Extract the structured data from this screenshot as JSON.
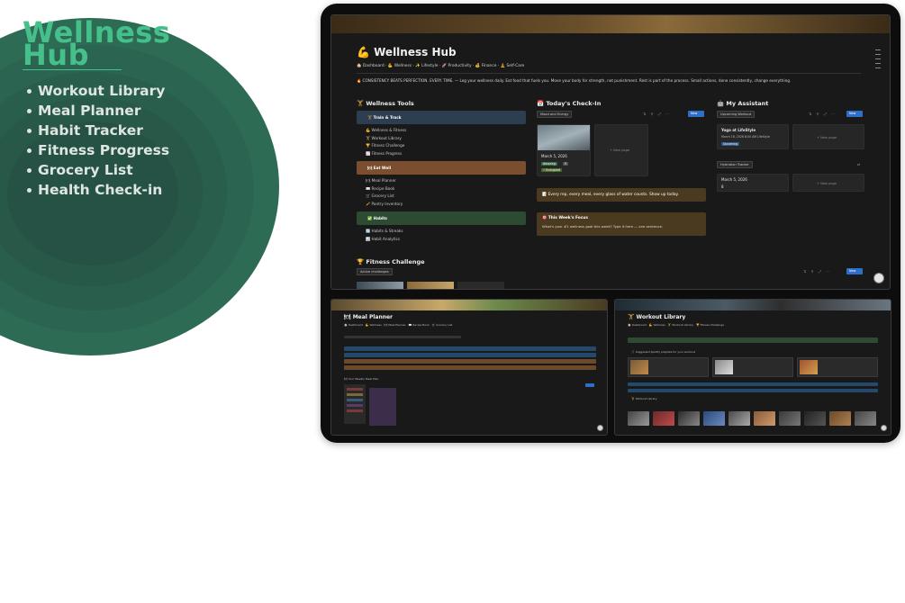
{
  "promo": {
    "brand_line1": "Wellness",
    "brand_line2": "Hub",
    "features": [
      "Workout Library",
      "Meal Planner",
      "Habit Tracker",
      "Fitness Progress",
      "Grocery List",
      "Health Check-in"
    ]
  },
  "main_page": {
    "title": "💪 Wellness Hub",
    "breadcrumb": "🏠 Dashboard · 💪 Wellness · ✨ Lifestyle · 🚀 Productivity · 💰 Finance · 🧘 Self-Care",
    "quote": "🔥 CONSISTENCY BEATS PERFECTION. EVERY. TIME. — Log your wellness daily. Eat food that fuels you. Move your body for strength, not punishment. Rest is part of the process. Small actions, done consistently, change everything.",
    "tools": {
      "heading": "🏋 Wellness Tools",
      "train_label": "🏋 Train & Track",
      "train_links": [
        "💪 Wellness & Fitness",
        "🏋 Workout Library",
        "🏆 Fitness Challenge",
        "📈 Fitness Progress"
      ],
      "eat_label": "🍽 Eat Well",
      "eat_links": [
        "🍽 Meal Planner",
        "📖 Recipe Book",
        "🛒 Grocery List",
        "🥕 Pantry Inventory"
      ],
      "habits_label": "✅ Habits",
      "habits_links": [
        "🔄 Habits & Streaks",
        "📊 Habit Analytics"
      ]
    },
    "checkin": {
      "heading": "📅 Today's Check-In",
      "tab": "Mood and Energy",
      "new_btn": "New",
      "card_date": "March 5, 2026",
      "card_tag1": "Amazing",
      "card_tag2": "5",
      "card_tag3": "⚡ Energized",
      "new_page": "+ New page",
      "callout1": "📝 Every rep, every meal, every glass of water counts. Show up today.",
      "focus_title": "🎯 This Week's Focus",
      "focus_text": "What's your #1 wellness goal this week? Type it here — one sentence."
    },
    "assistant": {
      "heading": "🤖 My Assistant",
      "tab": "Upcoming Workout",
      "new_btn": "New",
      "card_title": "Yoga at LifeStyle",
      "card_meta": "March 16, 2026 8:00 AM  LifeStyle",
      "card_pill": "Upcoming",
      "new_page": "+ New page",
      "tab2": "Hydration Tracker",
      "card2_date": "March 5, 2026",
      "card2_val": "8",
      "new_page2": "+ New page"
    },
    "challenge": {
      "heading": "🏆 Fitness Challenge",
      "tab": "Active challenges",
      "new_btn": "New"
    }
  },
  "meal_page": {
    "title": "🍽 Meal Planner",
    "breadcrumb": "🏠 Dashboard · 💪 Wellness · 🍽 Meal Planner · 📖 Recipe Book · 🛒 Grocery List",
    "section": "🍽 Your Weekly Meal Plan"
  },
  "workout_page": {
    "title": "🏋 Workout Library",
    "breadcrumb": "🏠 Dashboard · 💪 Wellness · 🏋 Workout Library · 🏆 Fitness Challenge",
    "playlist": "🎵 Suggested Spotify playlists for your workout",
    "library": "🏋 Workout Library"
  }
}
